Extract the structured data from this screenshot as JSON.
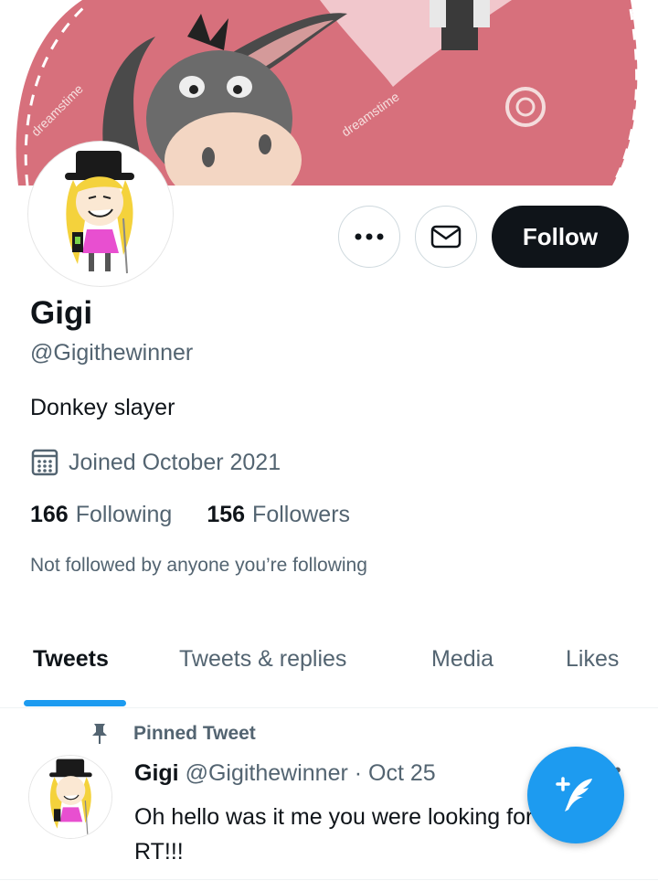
{
  "banner": {
    "watermark_1": "dreamstime",
    "watermark_2": "dreamstime",
    "icon": "donkey-banner-image"
  },
  "profile": {
    "name": "Gigi",
    "handle": "@Gigithewinner",
    "bio": "Donkey slayer",
    "joined": "Joined October 2021",
    "following_count": "166",
    "following_label": "Following",
    "followers_count": "156",
    "followers_label": "Followers",
    "not_followed": "Not followed by anyone you’re following"
  },
  "actions": {
    "more_icon": "more-icon",
    "message_icon": "envelope-icon",
    "follow_label": "Follow"
  },
  "tabs": [
    {
      "label": "Tweets",
      "active": true
    },
    {
      "label": "Tweets & replies",
      "active": false
    },
    {
      "label": "Media",
      "active": false
    },
    {
      "label": "Likes",
      "active": false
    }
  ],
  "pinned_tweet": {
    "pinned_label": "Pinned Tweet",
    "name": "Gigi",
    "handle": "@Gigithewinner",
    "separator": "·",
    "date": "Oct 25",
    "text_line1": "Oh hello was it me you were looking for",
    "text_line2": "RT!!!",
    "more_icon": "more-icon"
  },
  "colors": {
    "accent": "#1d9bf0",
    "follow_button": "#0f1419",
    "banner_pink": "#d9727e",
    "secondary_text": "#536471"
  }
}
